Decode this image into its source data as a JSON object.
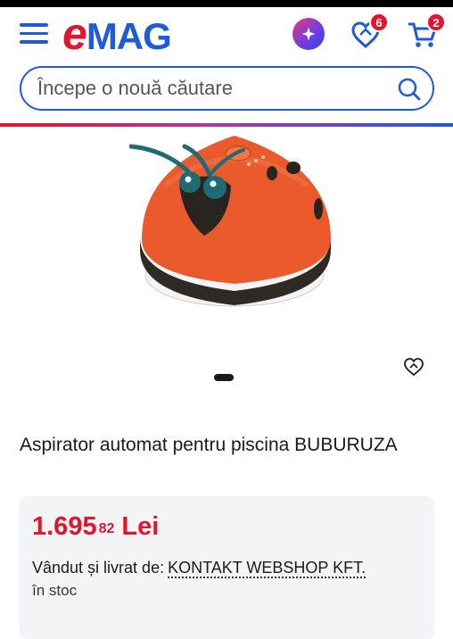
{
  "header": {
    "logo_e": "e",
    "logo_mag": "MAG",
    "favorites_count": "6",
    "cart_count": "2",
    "icons": [
      "menu-icon",
      "genius-icon",
      "heart-icon",
      "cart-icon"
    ],
    "colors": {
      "brand_blue": "#1f5bd6",
      "brand_red": "#e3142d"
    }
  },
  "search": {
    "placeholder": "Începe o nouă căutare"
  },
  "product": {
    "title": "Aspirator automat pentru piscina BUBURUZA",
    "price_int": "1.695",
    "price_cents": "82",
    "currency": "Lei",
    "seller_label": "Vândut și livrat de:",
    "seller_name": "KONTAKT WEBSHOP KFT.",
    "stock": "în stoc"
  }
}
